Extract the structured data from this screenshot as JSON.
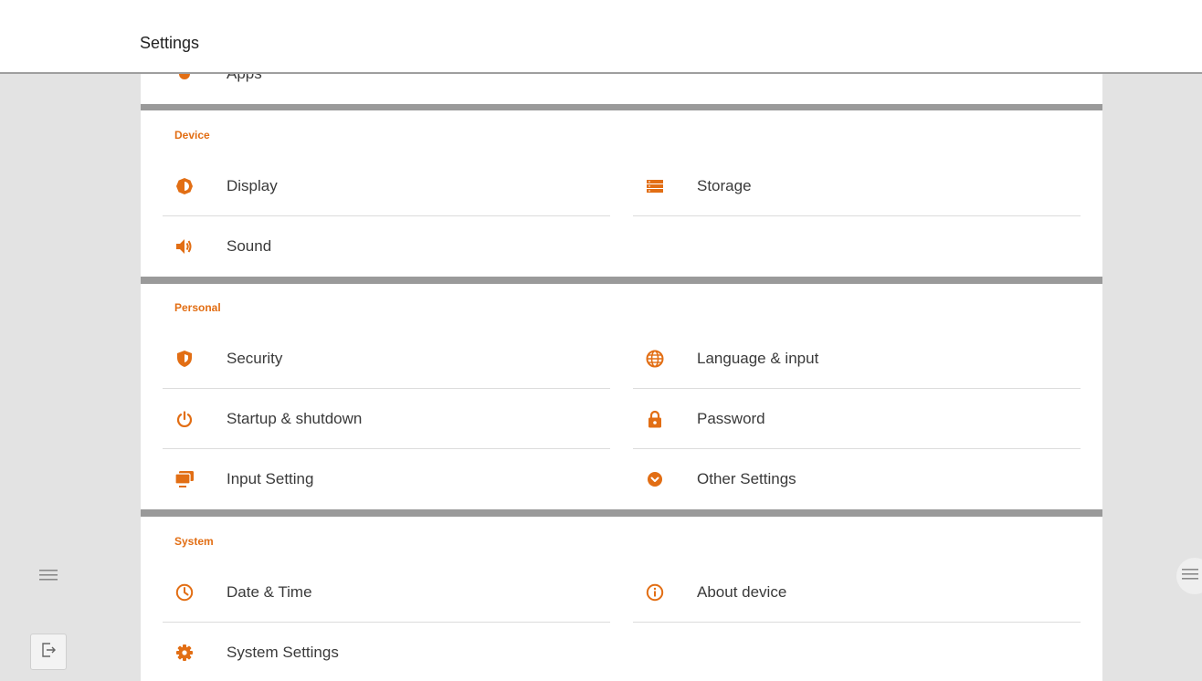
{
  "header": {
    "title": "Settings"
  },
  "apps_row": {
    "label": "Apps"
  },
  "sections": {
    "device": {
      "label": "Device",
      "items": [
        {
          "label": "Display",
          "icon": "brightness-icon"
        },
        {
          "label": "Storage",
          "icon": "storage-icon"
        },
        {
          "label": "Sound",
          "icon": "speaker-icon"
        }
      ]
    },
    "personal": {
      "label": "Personal",
      "items": [
        {
          "label": "Security",
          "icon": "shield-icon"
        },
        {
          "label": "Language & input",
          "icon": "globe-icon"
        },
        {
          "label": "Startup & shutdown",
          "icon": "power-icon"
        },
        {
          "label": "Password",
          "icon": "lock-icon"
        },
        {
          "label": "Input Setting",
          "icon": "monitor-icon"
        },
        {
          "label": "Other Settings",
          "icon": "chevron-circle-icon"
        }
      ]
    },
    "system": {
      "label": "System",
      "items": [
        {
          "label": "Date & Time",
          "icon": "clock-icon"
        },
        {
          "label": "About device",
          "icon": "info-icon"
        },
        {
          "label": "System Settings",
          "icon": "gear-icon"
        }
      ]
    }
  },
  "colors": {
    "accent": "#e26e14",
    "background": "#e3e3e3",
    "card": "#ffffff"
  }
}
